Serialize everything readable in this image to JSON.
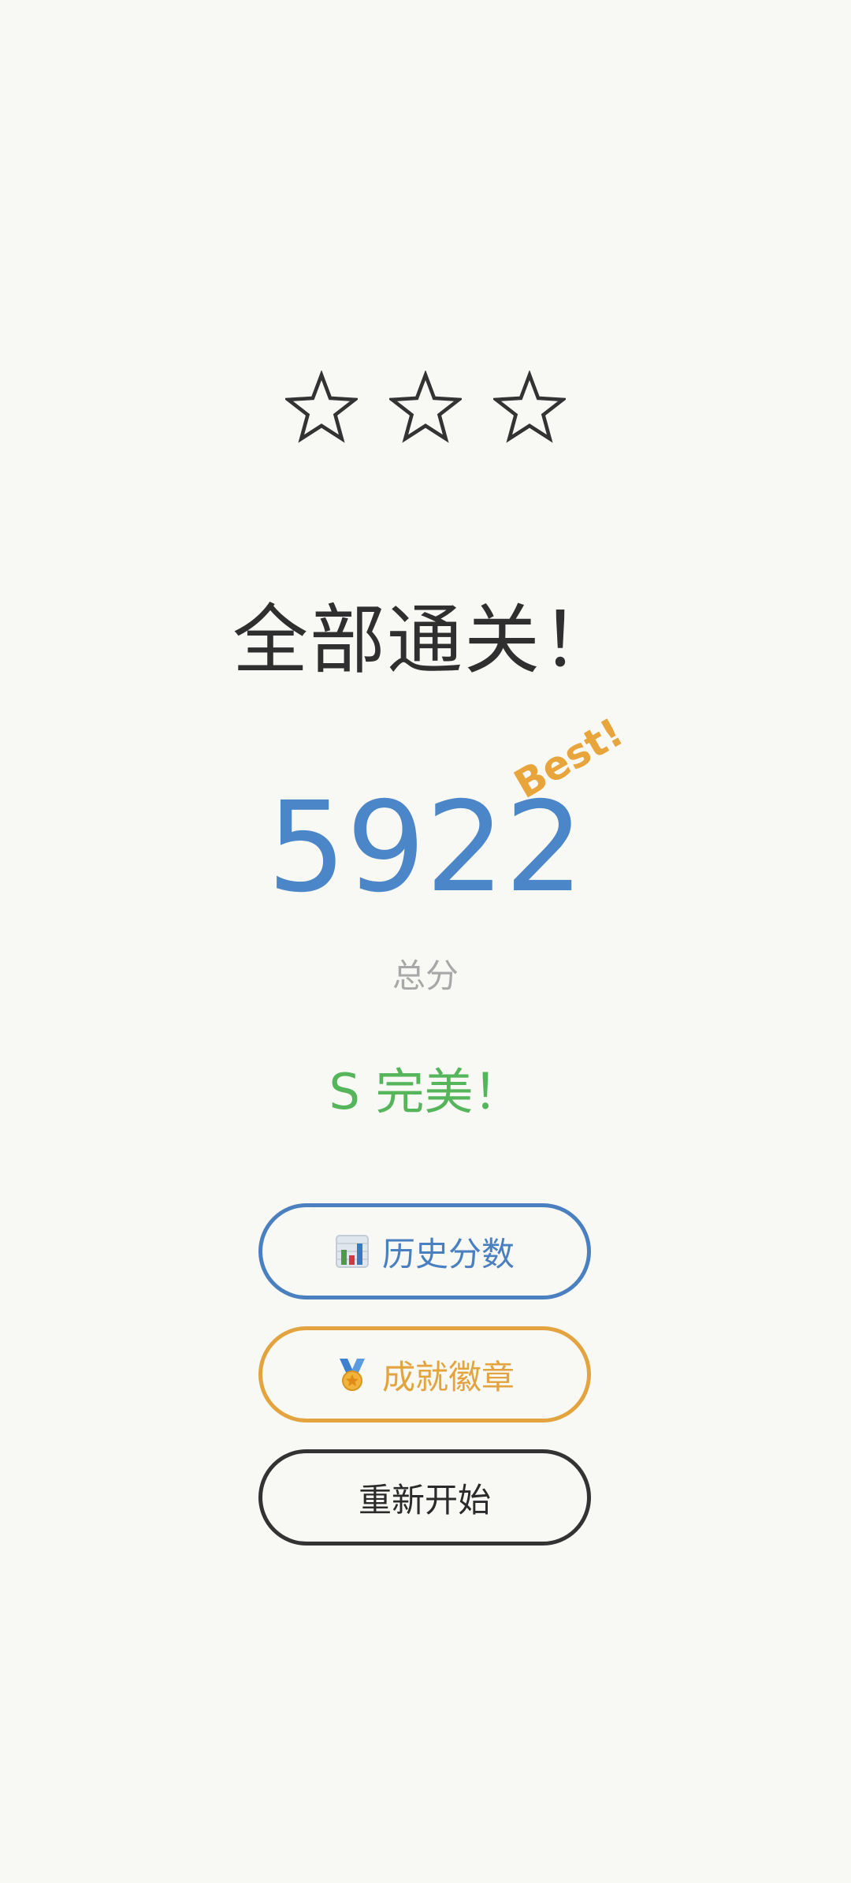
{
  "stars": {
    "earned": 0,
    "total": 3,
    "icon": "star-outline-icon",
    "stroke_color": "#333333"
  },
  "title": "全部通关！",
  "score": {
    "value": "5922",
    "badge": "Best!",
    "label": "总分",
    "color": "#4a86c8",
    "badge_color": "#e8a53c"
  },
  "rank": {
    "text": "S 完美！",
    "color": "#55b55a"
  },
  "buttons": {
    "history": {
      "label": "历史分数",
      "icon": "bar-chart-icon",
      "color": "#4a80c0"
    },
    "badges": {
      "label": "成就徽章",
      "icon": "medal-icon",
      "color": "#e3a43f"
    },
    "restart": {
      "label": "重新开始",
      "color": "#333333"
    }
  }
}
